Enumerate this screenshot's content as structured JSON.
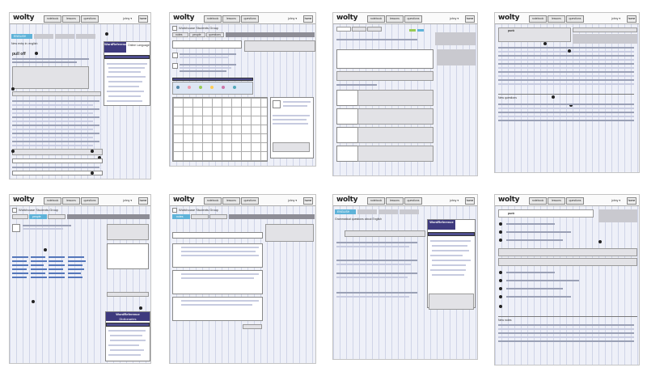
{
  "header": {
    "logo": "wolty",
    "tab_notebook": "notebook",
    "tab_lessons": "lessons",
    "tab_questions": "questions",
    "user_menu": "johny ▾",
    "home_label": "home"
  },
  "panels": {
    "p1": {
      "page_title": "New entry in: english",
      "word": "pull off",
      "lang_tabs": [
        "ENGLISH",
        "FRENCH",
        "GERMAN",
        "SPANISH"
      ]
    },
    "p2": {
      "group_name": "Workhouse Students Group",
      "tabs": [
        "notes",
        "people",
        "questions"
      ]
    },
    "p3": {
      "header_tabs": [
        "activity",
        "friends",
        "groups"
      ]
    },
    "p4": {
      "word": "punk",
      "section": "New questions"
    },
    "p5": {
      "group_name": "Workhouse Students Group",
      "tabs": [
        "notes",
        "people",
        "questions"
      ]
    },
    "p6": {
      "group_name": "Workhouse Students Group",
      "tabs": [
        "notes",
        "people",
        "questions"
      ]
    },
    "p7": {
      "lang_tabs": [
        "ENGLISH",
        "FRENCH",
        "GERMAN",
        "SPANISH"
      ],
      "title": "Grammatical questions about English"
    },
    "p8": {
      "word": "punk",
      "section": "New notes"
    }
  },
  "dictionary": {
    "brand": "WordReference",
    "sub": "Dictionaries",
    "tag": "Online Language"
  },
  "colors": {
    "accent": "#4d4c8c",
    "link_blue": "#5fb3d9",
    "panel_bg": "#eef0f8"
  }
}
